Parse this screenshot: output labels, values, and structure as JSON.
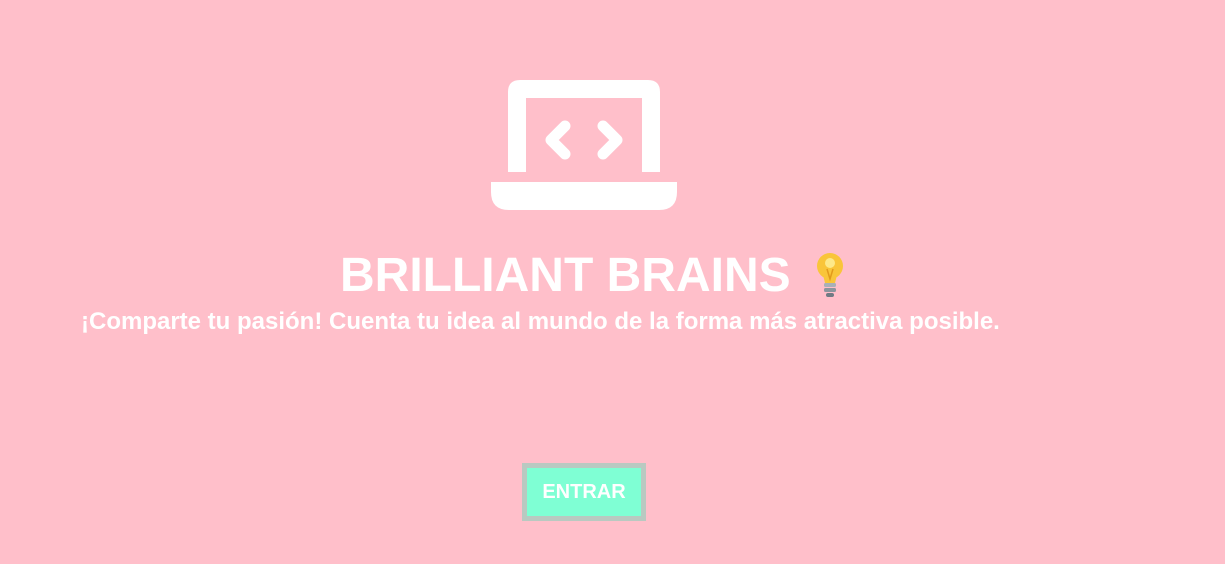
{
  "logo": {
    "icon": "laptop-code-icon",
    "color": "#ffffff"
  },
  "title": "BRILLIANT BRAINS",
  "title_icon": "lightbulb-icon",
  "tagline": "¡Comparte tu pasión! Cuenta tu idea al mundo de la forma más atractiva posible.",
  "enter_button": {
    "label": "ENTRAR",
    "background": "#7fffd4",
    "border": "#b9c9c1"
  },
  "colors": {
    "background": "#ffbfca",
    "text": "#ffffff"
  }
}
